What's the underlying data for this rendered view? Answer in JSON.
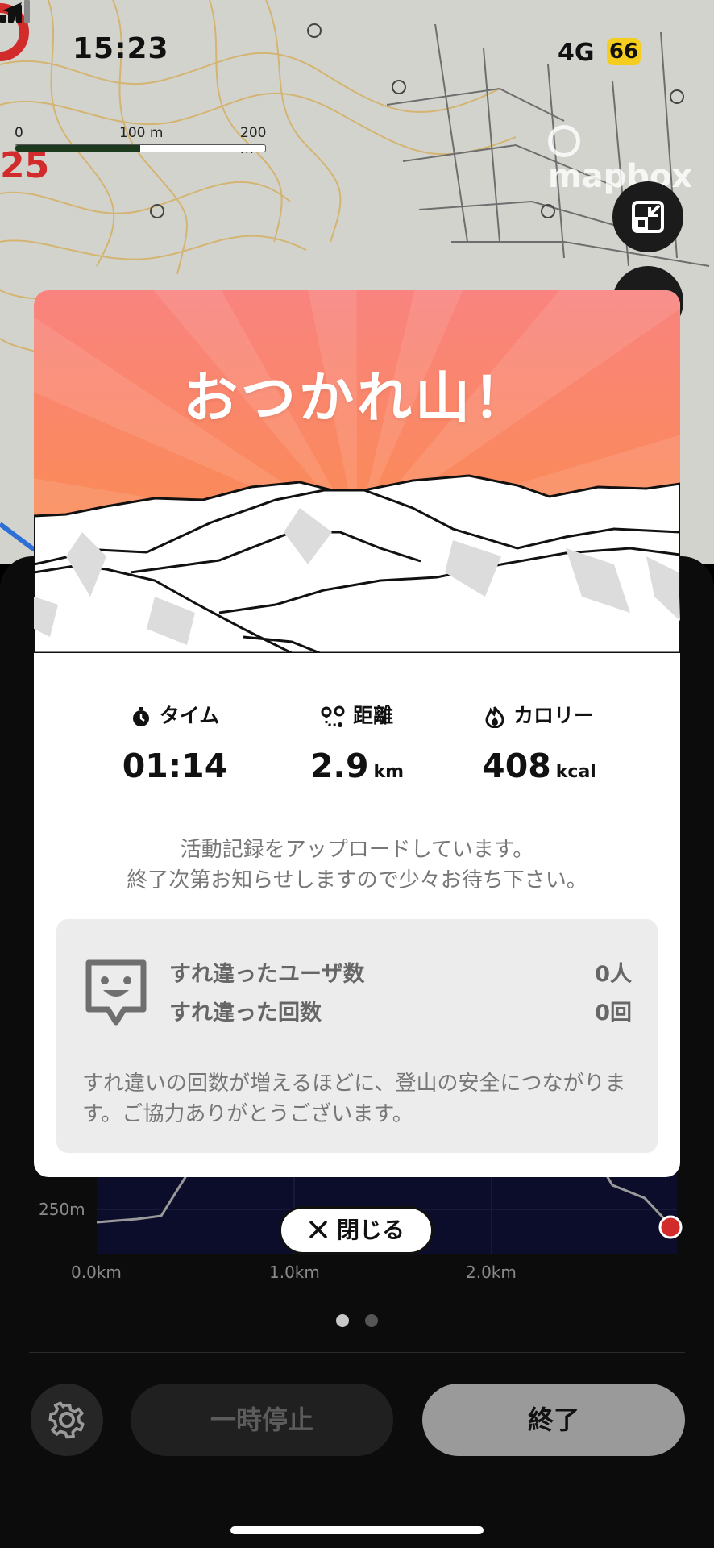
{
  "status_bar": {
    "time": "15:23",
    "network": "4G",
    "battery": "66",
    "location_icon": "location-arrow-icon",
    "signal_icon": "signal-bars-icon"
  },
  "map": {
    "scale_labels": [
      "0",
      "100 m",
      "200 m"
    ],
    "red_label": "25",
    "attribution": "mapbox",
    "expand_icon": "collapse-arrows-icon"
  },
  "modal": {
    "title": "おつかれ山！",
    "stats": [
      {
        "label": "タイム",
        "icon": "stopwatch-icon",
        "value": "01:14",
        "unit": ""
      },
      {
        "label": "距離",
        "icon": "route-icon",
        "value": "2.9",
        "unit": "km"
      },
      {
        "label": "カロリー",
        "icon": "flame-icon",
        "value": "408",
        "unit": "kcal"
      }
    ],
    "upload_message": [
      "活動記録をアップロードしています。",
      "終了次第お知らせしますので少々お待ち下さい。"
    ],
    "passing": {
      "icon": "face-chat-icon",
      "users_label": "すれ違ったユーザ数",
      "users_value": "0人",
      "count_label": "すれ違った回数",
      "count_value": "0回",
      "note": "すれ違いの回数が増えるほどに、登山の安全につながります。ご協力ありがとうございます。"
    }
  },
  "close_button": {
    "label": "閉じる",
    "icon": "close-icon"
  },
  "elevation_chart": {
    "y_label": "250m",
    "x_labels": [
      "0.0km",
      "1.0km",
      "2.0km"
    ]
  },
  "pager": {
    "pages": 2,
    "active": 0
  },
  "controls": {
    "settings_icon": "gear-icon",
    "pause_label": "一時停止",
    "end_label": "終了"
  },
  "colors": {
    "hero_top": "#f98a84",
    "hero_bottom": "#fb9a4c",
    "end_button": "#9a9a9a",
    "accent_red": "#d22b2b"
  }
}
